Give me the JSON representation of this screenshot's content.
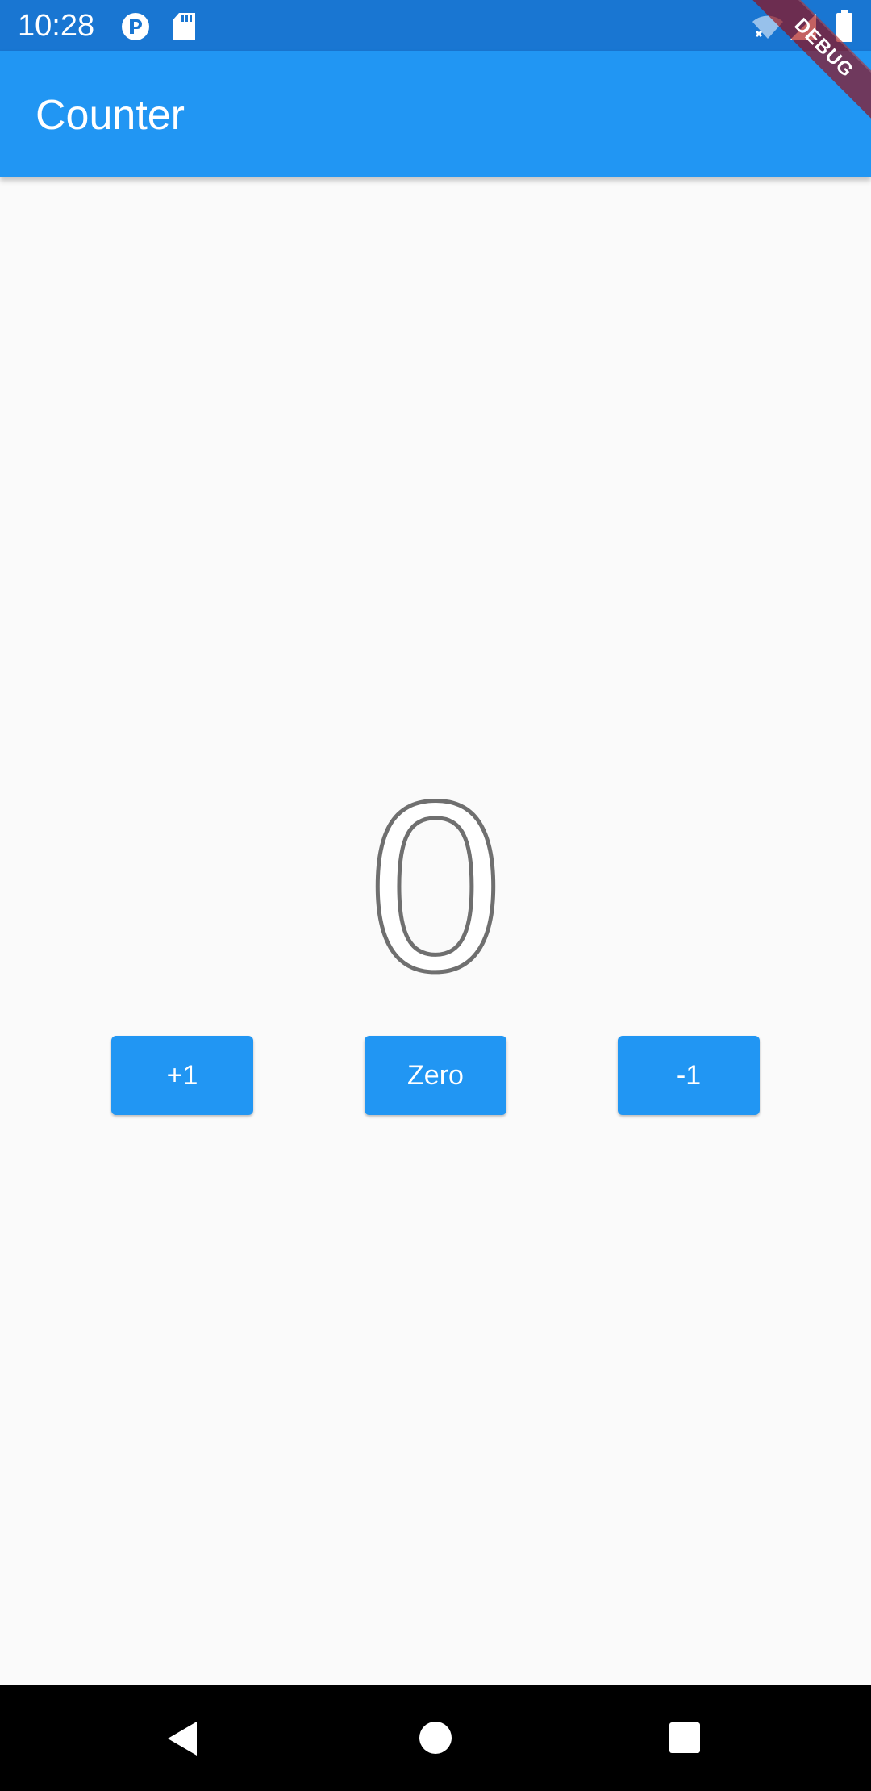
{
  "status_bar": {
    "time": "10:28",
    "icons": [
      "app-notification-icon",
      "sd-card-icon",
      "wifi-icon",
      "signal-icon",
      "battery-icon"
    ]
  },
  "app_bar": {
    "title": "Counter"
  },
  "debug_banner": {
    "label": "DEBUG"
  },
  "counter": {
    "value": "0"
  },
  "buttons": {
    "increment_label": "+1",
    "reset_label": "Zero",
    "decrement_label": "-1"
  },
  "nav_bar": {
    "icons": [
      "back-icon",
      "home-icon",
      "recents-icon"
    ]
  },
  "colors": {
    "primary": "#2196f3",
    "primary_dark": "#1976d2",
    "background": "#fafafa",
    "nav_bar": "#000000"
  }
}
